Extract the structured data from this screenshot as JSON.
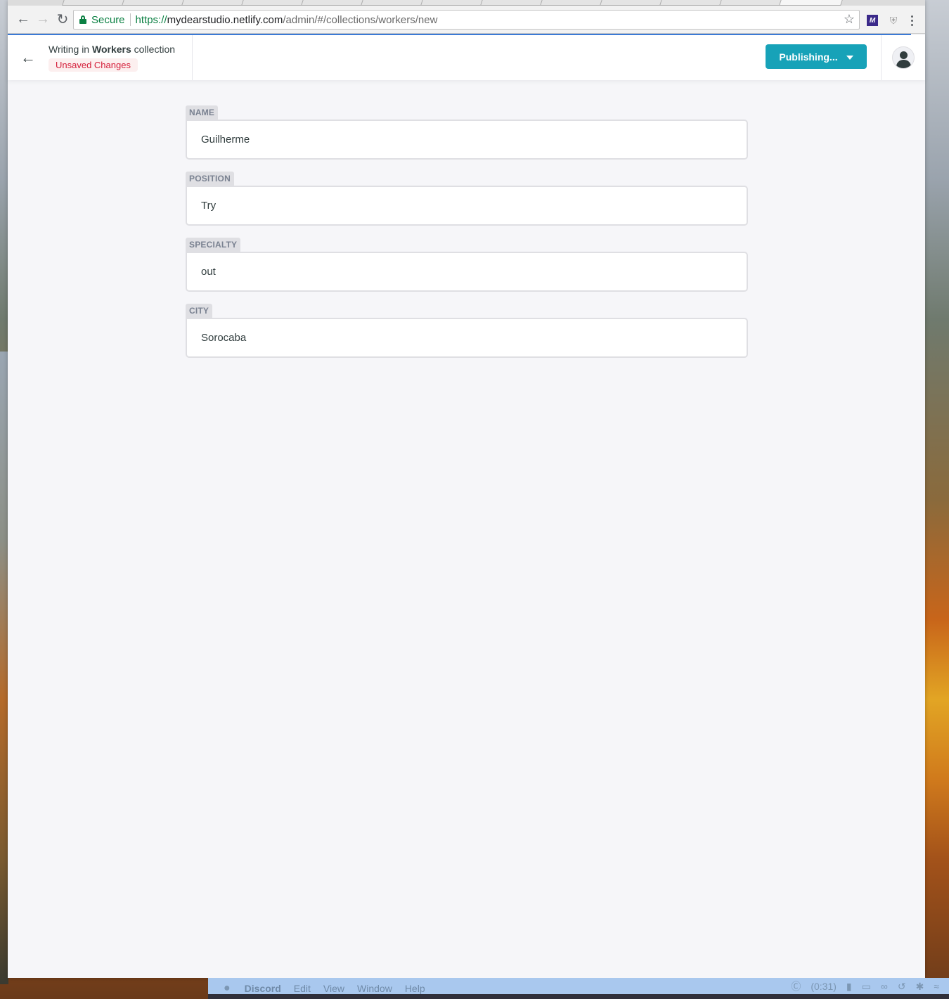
{
  "browser": {
    "secure_label": "Secure",
    "url_protocol": "https://",
    "url_host": "mydearstudio.netlify.com",
    "url_path": "/admin/#/collections/workers/new",
    "extension_label": "M"
  },
  "header": {
    "title_prefix": "Writing in",
    "collection_name": "Workers",
    "title_suffix": "collection",
    "status_badge": "Unsaved Changes",
    "publish_label": "Publishing..."
  },
  "fields": [
    {
      "label": "NAME",
      "value": "Guilherme"
    },
    {
      "label": "POSITION",
      "value": "Try"
    },
    {
      "label": "SPECIALTY",
      "value": "out"
    },
    {
      "label": "CITY",
      "value": "Sorocaba"
    }
  ],
  "menubar": {
    "app_name": "Discord",
    "items": [
      "Edit",
      "View",
      "Window",
      "Help"
    ],
    "battery_time": "(0:31)"
  },
  "colors": {
    "accent": "#17a2b8",
    "unsaved_text": "#d41d39",
    "unsaved_bg": "#fcefef",
    "secure_green": "#0b8043"
  }
}
